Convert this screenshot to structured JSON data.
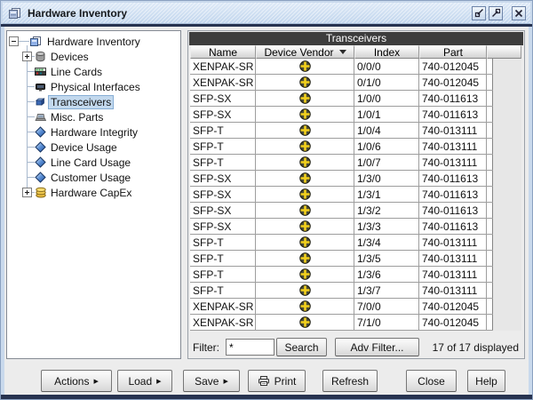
{
  "window": {
    "title": "Hardware Inventory",
    "icon": "hardware-inventory-icon",
    "controls": {
      "restore": "restore-down-icon",
      "maximize": "maximize-icon",
      "close": "close-icon"
    }
  },
  "tree": {
    "items": [
      {
        "label": "Hardware Inventory",
        "icon": "documents-icon",
        "depth": 0,
        "expander": "collapse",
        "selected": false
      },
      {
        "label": "Devices",
        "icon": "devices-icon",
        "depth": 1,
        "expander": "expand",
        "selected": false
      },
      {
        "label": "Line Cards",
        "icon": "line-card-icon",
        "depth": 1,
        "expander": null,
        "selected": false
      },
      {
        "label": "Physical Interfaces",
        "icon": "interface-icon",
        "depth": 1,
        "expander": null,
        "selected": false
      },
      {
        "label": "Transceivers",
        "icon": "transceiver-icon",
        "depth": 1,
        "expander": null,
        "selected": true
      },
      {
        "label": "Misc. Parts",
        "icon": "laptop-icon",
        "depth": 1,
        "expander": null,
        "selected": false
      },
      {
        "label": "Hardware Integrity",
        "icon": "diamond-icon",
        "depth": 1,
        "expander": null,
        "selected": false
      },
      {
        "label": "Device Usage",
        "icon": "diamond-icon",
        "depth": 1,
        "expander": null,
        "selected": false
      },
      {
        "label": "Line Card Usage",
        "icon": "diamond-icon",
        "depth": 1,
        "expander": null,
        "selected": false
      },
      {
        "label": "Customer Usage",
        "icon": "diamond-icon",
        "depth": 1,
        "expander": null,
        "selected": false
      },
      {
        "label": "Hardware CapEx",
        "icon": "coins-icon",
        "depth": 1,
        "expander": "expand",
        "selected": false
      }
    ]
  },
  "panel": {
    "title": "Transceivers",
    "vendor_icon": "juniper-logo-icon",
    "columns": [
      {
        "label": "Name",
        "sort": null
      },
      {
        "label": "Device Vendor",
        "sort": "desc"
      },
      {
        "label": "Index",
        "sort": null
      },
      {
        "label": "Part",
        "sort": null
      }
    ],
    "rows": [
      {
        "name": "XENPAK-SR",
        "index": "0/0/0",
        "part": "740-012045"
      },
      {
        "name": "XENPAK-SR",
        "index": "0/1/0",
        "part": "740-012045"
      },
      {
        "name": "SFP-SX",
        "index": "1/0/0",
        "part": "740-011613"
      },
      {
        "name": "SFP-SX",
        "index": "1/0/1",
        "part": "740-011613"
      },
      {
        "name": "SFP-T",
        "index": "1/0/4",
        "part": "740-013111"
      },
      {
        "name": "SFP-T",
        "index": "1/0/6",
        "part": "740-013111"
      },
      {
        "name": "SFP-T",
        "index": "1/0/7",
        "part": "740-013111"
      },
      {
        "name": "SFP-SX",
        "index": "1/3/0",
        "part": "740-011613"
      },
      {
        "name": "SFP-SX",
        "index": "1/3/1",
        "part": "740-011613"
      },
      {
        "name": "SFP-SX",
        "index": "1/3/2",
        "part": "740-011613"
      },
      {
        "name": "SFP-SX",
        "index": "1/3/3",
        "part": "740-011613"
      },
      {
        "name": "SFP-T",
        "index": "1/3/4",
        "part": "740-013111"
      },
      {
        "name": "SFP-T",
        "index": "1/3/5",
        "part": "740-013111"
      },
      {
        "name": "SFP-T",
        "index": "1/3/6",
        "part": "740-013111"
      },
      {
        "name": "SFP-T",
        "index": "1/3/7",
        "part": "740-013111"
      },
      {
        "name": "XENPAK-SR",
        "index": "7/0/0",
        "part": "740-012045"
      },
      {
        "name": "XENPAK-SR",
        "index": "7/1/0",
        "part": "740-012045"
      }
    ],
    "filter": {
      "label": "Filter:",
      "value": "*",
      "search_label": "Search",
      "adv_filter_label": "Adv Filter...",
      "status": "17 of 17 displayed"
    }
  },
  "actions_bar": {
    "buttons": [
      {
        "label": "Actions",
        "menu": true,
        "icon": null
      },
      {
        "label": "Load",
        "menu": true,
        "icon": null
      },
      {
        "label": "Save",
        "menu": true,
        "icon": null
      },
      {
        "label": "Print",
        "menu": false,
        "icon": "printer-icon"
      },
      {
        "label": "Refresh",
        "menu": false,
        "icon": null
      },
      {
        "label": "Close",
        "menu": false,
        "icon": null
      },
      {
        "label": "Help",
        "menu": false,
        "icon": null
      }
    ]
  },
  "colors": {
    "selection": "#c3d9ee",
    "panel_header": "#3d3d3d",
    "frame_navy": "#273350",
    "vendor_yellow": "#f2d01c"
  }
}
